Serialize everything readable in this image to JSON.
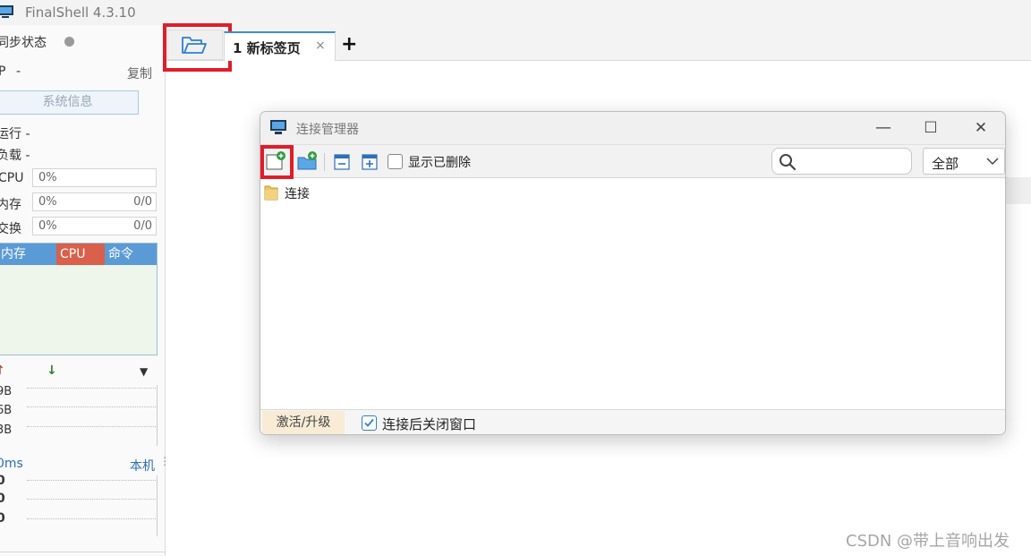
{
  "app": {
    "title": "FinalShell 4.3.10"
  },
  "left_panel": {
    "sync_status_label": "同步状态",
    "ip_label": "P",
    "ip_value": "-",
    "copy_label": "复制",
    "sysinfo_button": "系统信息",
    "run_label": "运行 -",
    "load_label": "负载 -",
    "cpu_label": "CPU",
    "cpu_value": "0%",
    "mem_label": "内存",
    "mem_value": "0%",
    "mem_right": "0/0",
    "swap_label": "交换",
    "swap_value": "0%",
    "swap_right": "0/0",
    "proc_headers": [
      "内存",
      "CPU",
      "命令"
    ],
    "net_rows": [
      "9B",
      "6B",
      "3B"
    ],
    "latency_label": "0ms",
    "local_label": "本机",
    "latency_rows": [
      "0",
      "0",
      "0"
    ]
  },
  "tabs": {
    "items": [
      {
        "label": "1 新标签页",
        "close": "×"
      }
    ],
    "add": "+"
  },
  "dialog": {
    "title": "连接管理器",
    "controls": {
      "minimize": "—",
      "maximize": "☐",
      "close": "✕"
    },
    "toolbar": {
      "show_deleted_label": "显示已删除",
      "search_placeholder": "",
      "filter_value": "全部"
    },
    "tree": [
      {
        "label": "连接"
      }
    ],
    "footer": {
      "activate_button": "激活/升级",
      "close_after_connect_label": "连接后关闭窗口",
      "close_after_connect_checked": true
    }
  },
  "watermark": "CSDN @带上音响出发",
  "colors": {
    "highlight": "#e11d2a",
    "proc_mem": "#5b9bd5",
    "proc_cpu": "#d9604a",
    "proc_cmd": "#5b9bd5",
    "accent": "#2d7fd0"
  }
}
